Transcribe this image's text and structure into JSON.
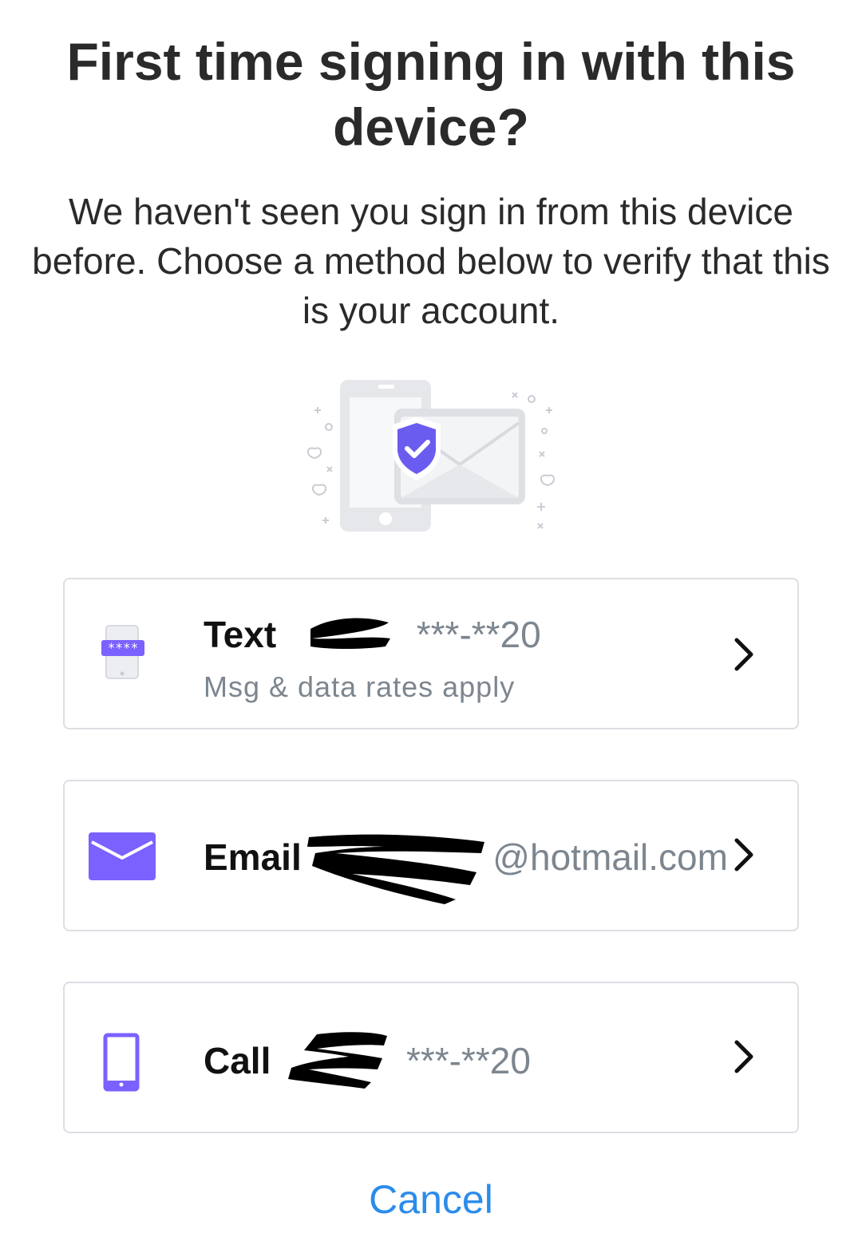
{
  "header": {
    "title": "First time signing in with this device?",
    "subtitle": "We haven't seen you sign in from this device before. Choose a method below to verify that this is your account."
  },
  "options": [
    {
      "method": "Text",
      "value": "***-**20",
      "subtitle": "Msg & data rates apply",
      "icon": "sms-phone-icon"
    },
    {
      "method": "Email",
      "value": "@hotmail.com",
      "icon": "envelope-icon"
    },
    {
      "method": "Call",
      "value": "***-**20",
      "icon": "phone-icon"
    }
  ],
  "cancel_label": "Cancel",
  "colors": {
    "accent": "#7B61FF",
    "link": "#2B8CEB",
    "muted": "#7D868F",
    "border": "#DCDFE3"
  }
}
